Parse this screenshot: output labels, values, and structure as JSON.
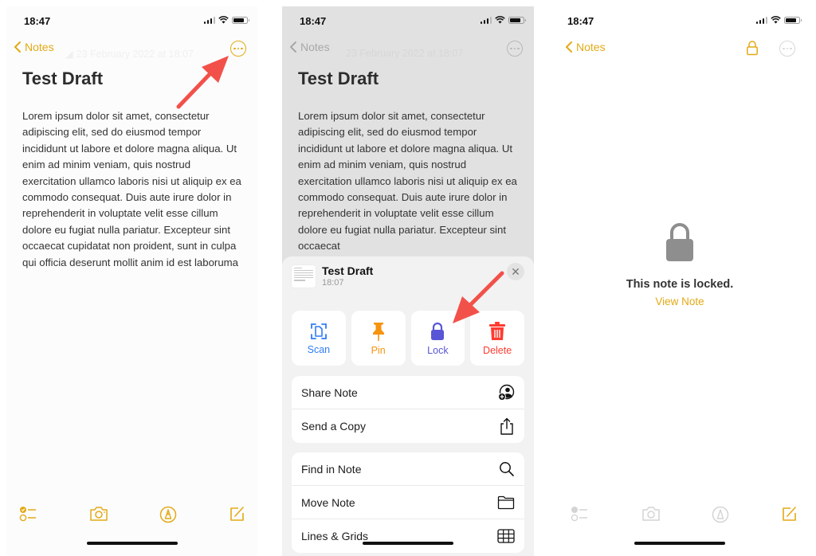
{
  "colors": {
    "accent": "#e3aa16",
    "arrow": "#f2514a",
    "scan": "#2f7cf6",
    "pin": "#f7930f",
    "lock": "#5856d6",
    "delete": "#ff3b30",
    "disabled": "#d4d4d4"
  },
  "status_bar": {
    "time": "18:47"
  },
  "screens": [
    {
      "nav": {
        "back_label": "Notes",
        "date": "23 February 2022 at 18:07"
      },
      "note": {
        "title": "Test Draft",
        "body": "Lorem ipsum dolor sit amet, consectetur adipiscing elit, sed do eiusmod tempor incididunt ut labore et dolore magna aliqua. Ut enim ad minim veniam, quis nostrud exercitation ullamco laboris nisi ut aliquip ex ea commodo consequat. Duis aute irure dolor in reprehenderit in voluptate velit esse cillum dolore eu fugiat nulla pariatur. Excepteur sint occaecat cupidatat non proident, sunt in culpa qui officia deserunt mollit anim id est laboruma"
      },
      "toolbar": [
        "checklist-icon",
        "camera-icon",
        "markup-icon",
        "compose-icon"
      ]
    },
    {
      "nav": {
        "back_label": "Notes",
        "date": "23 February 2022 at 18:07"
      },
      "note": {
        "title": "Test Draft",
        "body": "Lorem ipsum dolor sit amet, consectetur adipiscing elit, sed do eiusmod tempor incididunt ut labore et dolore magna aliqua. Ut enim ad minim veniam, quis nostrud exercitation ullamco laboris nisi ut aliquip ex ea commodo consequat. Duis aute irure dolor in reprehenderit in voluptate velit esse cillum dolore eu fugiat nulla pariatur. Excepteur sint occaecat"
      },
      "sheet": {
        "title": "Test Draft",
        "time": "18:07",
        "actions": [
          {
            "label": "Scan",
            "icon": "scan-icon"
          },
          {
            "label": "Pin",
            "icon": "pin-icon"
          },
          {
            "label": "Lock",
            "icon": "lock-icon"
          },
          {
            "label": "Delete",
            "icon": "trash-icon"
          }
        ],
        "group1": [
          {
            "label": "Share Note",
            "icon": "share-note-icon"
          },
          {
            "label": "Send a Copy",
            "icon": "share-icon"
          }
        ],
        "group2": [
          {
            "label": "Find in Note",
            "icon": "search-icon"
          },
          {
            "label": "Move Note",
            "icon": "folder-icon"
          },
          {
            "label": "Lines & Grids",
            "icon": "grid-icon"
          }
        ]
      }
    },
    {
      "nav": {
        "back_label": "Notes"
      },
      "locked": {
        "message": "This note is locked.",
        "link": "View Note"
      },
      "toolbar": [
        "checklist-icon",
        "camera-icon",
        "markup-icon",
        "compose-icon"
      ]
    }
  ]
}
